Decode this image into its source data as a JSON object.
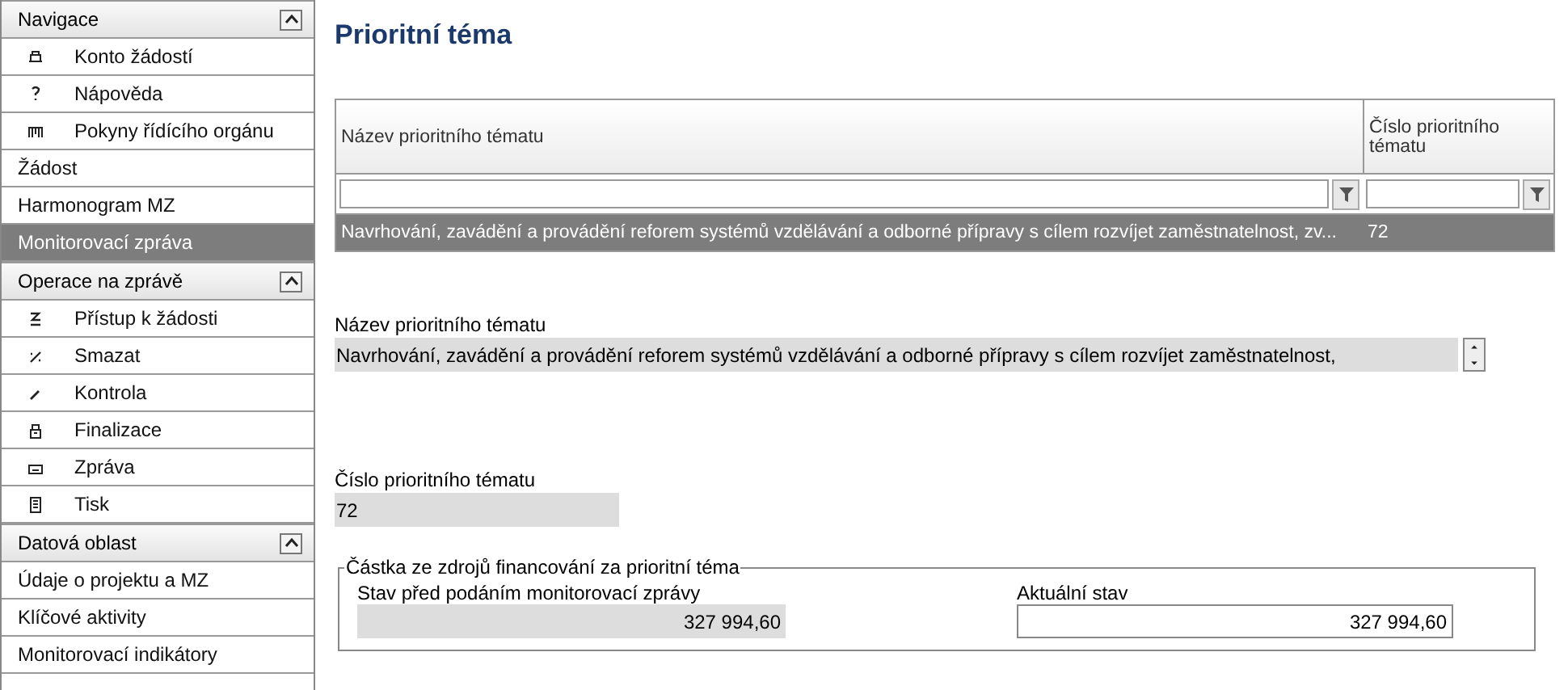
{
  "sidebar": {
    "sections": [
      {
        "title": "Navigace",
        "expanded": true,
        "items": [
          {
            "label": "Konto žádostí",
            "kind": "icon",
            "selected": false
          },
          {
            "label": "Nápověda",
            "kind": "icon",
            "selected": false
          },
          {
            "label": "Pokyny řídícího orgánu",
            "kind": "icon",
            "selected": false
          },
          {
            "label": "Žádost",
            "kind": "plain",
            "selected": false
          },
          {
            "label": "Harmonogram MZ",
            "kind": "plain",
            "selected": false
          },
          {
            "label": "Monitorovací zpráva",
            "kind": "plain",
            "selected": true
          }
        ]
      },
      {
        "title": "Operace na zprávě",
        "expanded": true,
        "items": [
          {
            "label": "Přístup k žádosti",
            "kind": "icon",
            "selected": false
          },
          {
            "label": "Smazat",
            "kind": "icon",
            "selected": false
          },
          {
            "label": "Kontrola",
            "kind": "icon",
            "selected": false
          },
          {
            "label": "Finalizace",
            "kind": "icon",
            "selected": false
          },
          {
            "label": "Zpráva",
            "kind": "icon",
            "selected": false
          },
          {
            "label": "Tisk",
            "kind": "icon",
            "selected": false
          }
        ]
      },
      {
        "title": "Datová oblast",
        "expanded": true,
        "items": [
          {
            "label": "Údaje o projektu a MZ",
            "kind": "plain",
            "selected": false
          },
          {
            "label": "Klíčové aktivity",
            "kind": "plain",
            "selected": false
          },
          {
            "label": "Monitorovací indikátory",
            "kind": "plain",
            "selected": false
          }
        ]
      }
    ]
  },
  "page_title": "Prioritní téma",
  "table": {
    "columns": [
      "Název prioritního tématu",
      "Číslo prioritního tématu"
    ],
    "rows": [
      {
        "cells": [
          "Navrhování, zavádění a provádění reforem systémů vzdělávání a odborné přípravy s cílem rozvíjet zaměstnatelnost, zv...",
          "72"
        ],
        "selected": true
      }
    ]
  },
  "form": {
    "name_label": "Název prioritního tématu",
    "name_value": "Navrhování, zavádění a provádění reforem systémů vzdělávání a odborné přípravy s cílem rozvíjet zaměstnatelnost,",
    "number_label": "Číslo prioritního tématu",
    "number_value": "72",
    "group": {
      "legend": "Částka ze zdrojů financování za prioritní téma",
      "before_label": "Stav před podáním monitorovací zprávy",
      "before_value": "327 994,60",
      "current_label": "Aktuální stav",
      "current_value": "327 994,60"
    }
  }
}
